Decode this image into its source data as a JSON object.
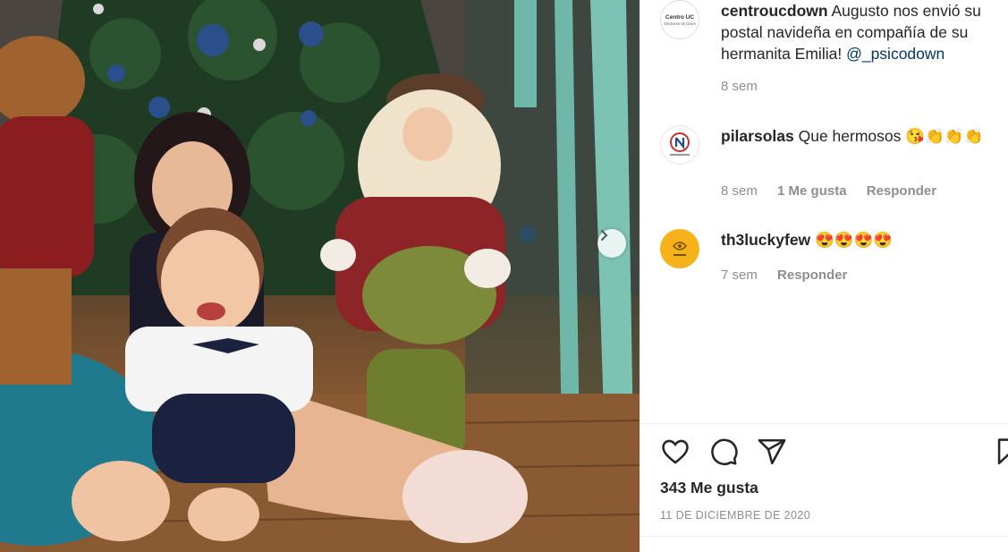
{
  "post": {
    "next_icon": "chevron-right-icon"
  },
  "comments": [
    {
      "username": "centroucdown",
      "avatar_text": "Centro UC Síndrome de Down",
      "text": "Augusto nos envió su postal navideña en compañía de su hermanita Emilia!",
      "mention": "@_psicodown",
      "time": "8 sem"
    },
    {
      "username": "pilarsolas",
      "text": "Que hermosos 😘👏👏👏",
      "time": "8 sem",
      "likes": "1 Me gusta",
      "reply": "Responder"
    },
    {
      "username": "th3luckyfew",
      "text": "😍😍😍😍",
      "time": "7 sem",
      "reply": "Responder"
    }
  ],
  "actions": {
    "like_icon": "heart-icon",
    "comment_icon": "comment-icon",
    "share_icon": "paper-plane-icon",
    "save_icon": "bookmark-icon"
  },
  "likes_label": "343 Me gusta",
  "date_label": "11 DE DICIEMBRE DE 2020",
  "colors": {
    "mention": "#00376b",
    "secondary_text": "#8e8e8e",
    "primary_text": "#262626",
    "lucky_few_avatar": "#f5b21a"
  }
}
